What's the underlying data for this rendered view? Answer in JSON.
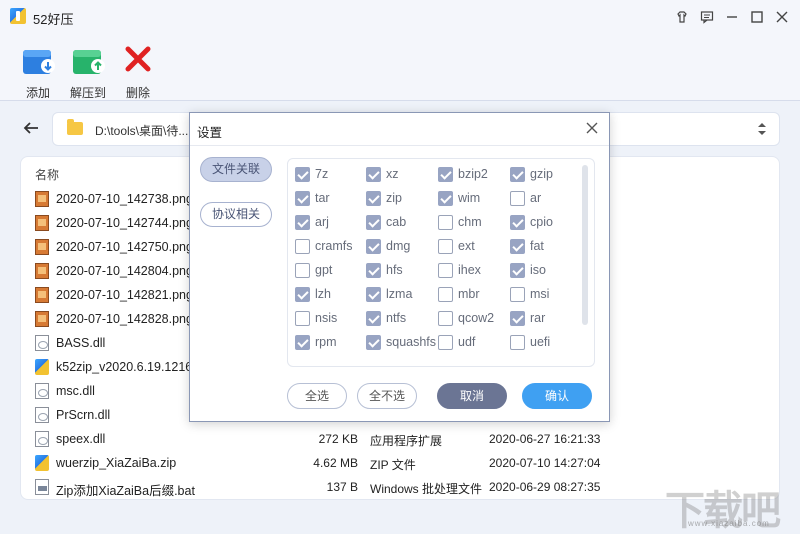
{
  "window": {
    "title": "52好压"
  },
  "toolbar": {
    "add_label": "添加",
    "extract_label": "解压到",
    "delete_label": "删除"
  },
  "address": {
    "path": "D:\\tools\\桌面\\待..."
  },
  "list": {
    "header_name": "名称",
    "rows": [
      {
        "name": "2020-07-10_142738.png",
        "size": "",
        "type": "",
        "date": "",
        "icon": "image-file-icon"
      },
      {
        "name": "2020-07-10_142744.png",
        "size": "",
        "type": "",
        "date": "",
        "icon": "image-file-icon"
      },
      {
        "name": "2020-07-10_142750.png",
        "size": "",
        "type": "",
        "date": "",
        "icon": "image-file-icon"
      },
      {
        "name": "2020-07-10_142804.png",
        "size": "",
        "type": "",
        "date": "",
        "icon": "image-file-icon"
      },
      {
        "name": "2020-07-10_142821.png",
        "size": "",
        "type": "",
        "date": "",
        "icon": "image-file-icon"
      },
      {
        "name": "2020-07-10_142828.png",
        "size": "",
        "type": "",
        "date": "",
        "icon": "image-file-icon"
      },
      {
        "name": "BASS.dll",
        "size": "",
        "type": "",
        "date": "",
        "icon": "dll-file-icon"
      },
      {
        "name": "k52zip_v2020.6.19.1216",
        "size": "",
        "type": "",
        "date": "",
        "icon": "app-file-icon"
      },
      {
        "name": "msc.dll",
        "size": "",
        "type": "",
        "date": "",
        "icon": "dll-file-icon"
      },
      {
        "name": "PrScrn.dll",
        "size": "",
        "type": "",
        "date": "",
        "icon": "dll-file-icon"
      },
      {
        "name": "speex.dll",
        "size": "272 KB",
        "type": "应用程序扩展",
        "date": "2020-06-27 16:21:33",
        "icon": "dll-file-icon"
      },
      {
        "name": "wuerzip_XiaZaiBa.zip",
        "size": "4.62 MB",
        "type": "ZIP 文件",
        "date": "2020-07-10 14:27:04",
        "icon": "zip-file-icon"
      },
      {
        "name": "Zip添加XiaZaiBa后缀.bat",
        "size": "137 B",
        "type": "Windows 批处理文件",
        "date": "2020-06-29 08:27:35",
        "icon": "bat-file-icon"
      }
    ]
  },
  "dialog": {
    "title": "设置",
    "tabs": [
      "文件关联",
      "协议相关"
    ],
    "formats": [
      {
        "label": "7z",
        "checked": true
      },
      {
        "label": "xz",
        "checked": true
      },
      {
        "label": "bzip2",
        "checked": true
      },
      {
        "label": "gzip",
        "checked": true
      },
      {
        "label": "tar",
        "checked": true
      },
      {
        "label": "zip",
        "checked": true
      },
      {
        "label": "wim",
        "checked": true
      },
      {
        "label": "ar",
        "checked": false
      },
      {
        "label": "arj",
        "checked": true
      },
      {
        "label": "cab",
        "checked": true
      },
      {
        "label": "chm",
        "checked": false
      },
      {
        "label": "cpio",
        "checked": true
      },
      {
        "label": "cramfs",
        "checked": false
      },
      {
        "label": "dmg",
        "checked": true
      },
      {
        "label": "ext",
        "checked": false
      },
      {
        "label": "fat",
        "checked": true
      },
      {
        "label": "gpt",
        "checked": false
      },
      {
        "label": "hfs",
        "checked": true
      },
      {
        "label": "ihex",
        "checked": false
      },
      {
        "label": "iso",
        "checked": true
      },
      {
        "label": "lzh",
        "checked": true
      },
      {
        "label": "lzma",
        "checked": true
      },
      {
        "label": "mbr",
        "checked": false
      },
      {
        "label": "msi",
        "checked": false
      },
      {
        "label": "nsis",
        "checked": false
      },
      {
        "label": "ntfs",
        "checked": true
      },
      {
        "label": "qcow2",
        "checked": false
      },
      {
        "label": "rar",
        "checked": true
      },
      {
        "label": "rpm",
        "checked": true
      },
      {
        "label": "squashfs",
        "checked": true
      },
      {
        "label": "udf",
        "checked": false
      },
      {
        "label": "uefi",
        "checked": false
      }
    ],
    "select_all": "全选",
    "select_none": "全不选",
    "cancel": "取消",
    "confirm": "确认"
  },
  "watermark": {
    "text": "下载吧",
    "url": "www.xiazaiba.com"
  }
}
